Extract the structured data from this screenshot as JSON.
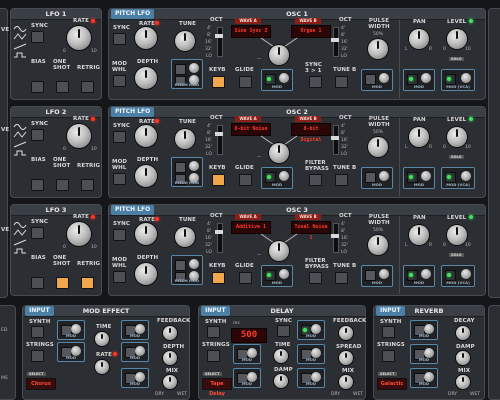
{
  "lfo_rows": [
    {
      "title": "LFO 1",
      "rate": "RATE",
      "sync": "SYNC",
      "bias": "BIAS",
      "one_shot": "ONE SHOT",
      "retrig": "RETRIG"
    },
    {
      "title": "LFO 2",
      "rate": "RATE",
      "sync": "SYNC",
      "bias": "BIAS",
      "one_shot": "ONE SHOT",
      "retrig": "RETRIG"
    },
    {
      "title": "LFO 3",
      "rate": "RATE",
      "sync": "SYNC",
      "bias": "BIAS",
      "one_shot": "ONE SHOT",
      "retrig": "RETRIG"
    }
  ],
  "osc_rows": [
    {
      "title": "OSC 1",
      "pitch_lfo": "PITCH LFO",
      "wave_a": "Sine Sync 2",
      "wave_b": "Organ 1",
      "extra_label": "SYNC 3 > 1",
      "tune_b": "TUNE B"
    },
    {
      "title": "OSC 2",
      "pitch_lfo": "PITCH LFO",
      "wave_a": "8-bit Noise",
      "wave_b": "8-bit Digital",
      "extra_label": "FILTER BYPASS",
      "tune_b": "TUNE B"
    },
    {
      "title": "OSC 3",
      "pitch_lfo": "PITCH LFO",
      "wave_a": "Additive 1",
      "wave_b": "Tonal Noise 1",
      "extra_label": "FILTER BYPASS",
      "tune_b": "TUNE B"
    }
  ],
  "common": {
    "wave_tab_a": "WAVE A",
    "wave_tab_b": "WAVE B",
    "tune": "TUNE",
    "oct": "OCT",
    "oct_marks": [
      "4'",
      "8'",
      "16'",
      "32'"
    ],
    "lo": "LO",
    "keyb": "KEYB",
    "glide": "GLIDE",
    "pulse_width": "PULSE WIDTH",
    "pw_value": "50%",
    "pan": "PAN",
    "level": "LEVEL",
    "solo": "SOLO",
    "mod": "MOD",
    "mod_vca": "MOD (VCA)",
    "mod_whl": "MOD WHL",
    "depth": "DEPTH",
    "rate": "RATE",
    "sync": "SYNC",
    "pitch_mod": "PITCH MOD",
    "l": "L",
    "r": "R",
    "zero": "0",
    "ten": "10",
    "dash": "—"
  },
  "mod_effect": {
    "title": "MOD EFFECT",
    "input": "INPUT",
    "synth": "SYNTH",
    "strings": "STRINGS",
    "select": "SELECT",
    "type": "Chorus",
    "time": "TIME",
    "rate": "RATE",
    "feedback": "FEEDBACK",
    "depth": "DEPTH",
    "mix": "MIX",
    "dry": "DRY",
    "wet": "WET",
    "mod": "MOD"
  },
  "delay": {
    "title": "DELAY",
    "input": "INPUT",
    "synth": "SYNTH",
    "strings": "STRINGS",
    "ms_label": "ms",
    "ms_value": "500",
    "select": "SELECT",
    "type": "Tape Delay",
    "sync": "SYNC",
    "time": "TIME",
    "damp": "DAMP",
    "feedback": "FEEDBACK",
    "spread": "SPREAD",
    "mix": "MIX",
    "dry": "DRY",
    "wet": "WET",
    "mod": "MOD"
  },
  "reverb": {
    "title": "REVERB",
    "input": "INPUT",
    "synth": "SYNTH",
    "strings": "STRINGS",
    "select": "SELECT",
    "type": "Galactic",
    "decay": "DECAY",
    "damp": "DAMP",
    "mix": "MIX",
    "dry": "DRY",
    "wet": "WET",
    "mod": "MOD"
  },
  "left_strip": {
    "ve": "VE",
    "ed": "ED",
    "ms": "MS"
  }
}
